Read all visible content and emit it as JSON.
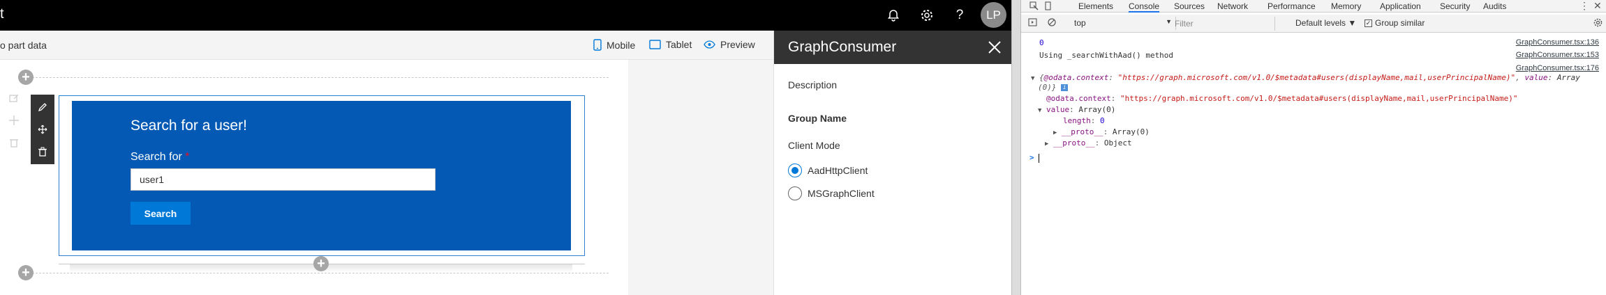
{
  "workbench": {
    "title_fragment": "t",
    "topbar_icons": [
      "bell-icon",
      "gear-icon",
      "help-icon"
    ],
    "avatar_initials": "LP",
    "cmdbar_left_text": "o part data",
    "commands": [
      {
        "label": "Mobile",
        "icon": "mobile-icon"
      },
      {
        "label": "Tablet",
        "icon": "tablet-icon"
      },
      {
        "label": "Preview",
        "icon": "eye-icon"
      }
    ],
    "webpart": {
      "heading": "Search for a user!",
      "search_label": "Search for",
      "required_mark": "*",
      "input_value": "user1",
      "button_label": "Search"
    }
  },
  "property_pane": {
    "title": "GraphConsumer",
    "description_label": "Description",
    "group_name_label": "Group Name",
    "client_mode_label": "Client Mode",
    "options": [
      {
        "label": "AadHttpClient",
        "selected": true
      },
      {
        "label": "MSGraphClient",
        "selected": false
      }
    ]
  },
  "devtools": {
    "tabs": [
      "Elements",
      "Console",
      "Sources",
      "Network",
      "Performance",
      "Memory",
      "Application",
      "Security",
      "Audits"
    ],
    "active_tab": "Console",
    "context": "top",
    "filter_placeholder": "Filter",
    "levels": "Default levels ▼",
    "group_similar": "Group similar",
    "console_lines": {
      "l1_value": "0",
      "l1_src": "GraphConsumer.tsx:136",
      "l2_text": "Using _searchWithAad() method",
      "l2_src": "GraphConsumer.tsx:153",
      "l3_src": "GraphConsumer.tsx:176",
      "l3_key1": "@odata.context",
      "l3_str1": "\"https://graph.microsoft.com/v1.0/$metadata#users(displayName,mail,userPrincipalName)\"",
      "l3_key2": "value",
      "l3_val2": "Array",
      "l3_cont": "(0)}",
      "l4_key": "@odata.context",
      "l4_str": "\"https://graph.microsoft.com/v1.0/$metadata#users(displayName,mail,userPrincipalName)\"",
      "l5_key": "value",
      "l5_val": "Array(0)",
      "l6_key": "length",
      "l6_val": "0",
      "l7_key": "__proto__",
      "l7_val": "Array(0)",
      "l8_key": "__proto__",
      "l8_val": "Object",
      "prompt": ">"
    }
  }
}
